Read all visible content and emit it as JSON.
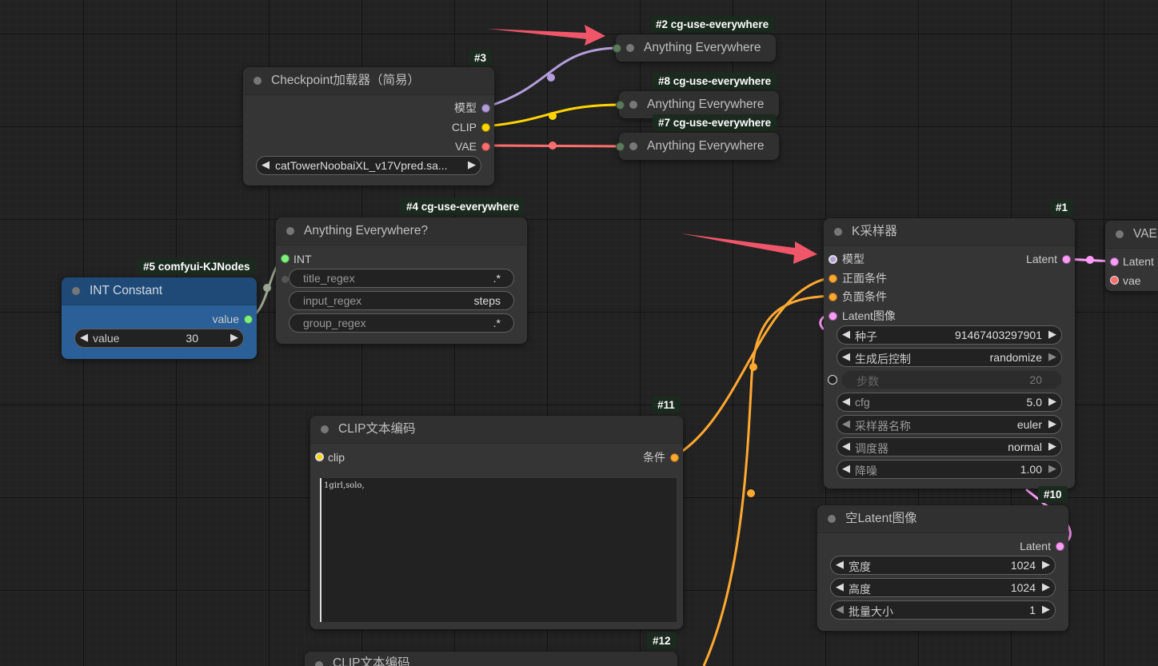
{
  "colors": {
    "model": "#b39ddb",
    "clip": "#ffd500",
    "vae": "#ff6e6e",
    "conditioning": "#ffa931",
    "latent": "#ff9cf9",
    "int": "#7ef07e",
    "annotation_arrow": "#f0566a"
  },
  "nodes": {
    "checkpoint": {
      "badge": "#3",
      "title": "Checkpoint加载器（简易）",
      "outputs": [
        "模型",
        "CLIP",
        "VAE"
      ],
      "ckpt_name": "catTowerNoobaiXL_v17Vpred.sa..."
    },
    "ae2": {
      "badge": "#2 cg-use-everywhere",
      "title": "Anything Everywhere"
    },
    "ae8": {
      "badge": "#8 cg-use-everywhere",
      "title": "Anything Everywhere"
    },
    "ae7": {
      "badge": "#7 cg-use-everywhere",
      "title": "Anything Everywhere"
    },
    "ae4": {
      "badge": "#4 cg-use-everywhere",
      "title": "Anything Everywhere?",
      "input": "INT",
      "widgets": [
        {
          "label": "title_regex",
          "value": ".*"
        },
        {
          "label": "input_regex",
          "value": "steps"
        },
        {
          "label": "group_regex",
          "value": ".*"
        }
      ]
    },
    "int_constant": {
      "badge": "#5 comfyui-KJNodes",
      "title": "INT Constant",
      "output": "value",
      "widget": {
        "label": "value",
        "value": "30"
      }
    },
    "ksampler": {
      "badge": "#1",
      "title": "K采样器",
      "inputs": [
        "模型",
        "正面条件",
        "负面条件",
        "Latent图像"
      ],
      "output": "Latent",
      "widgets": [
        {
          "label": "种子",
          "value": "91467403297901"
        },
        {
          "label": "生成后控制",
          "value": "randomize"
        },
        {
          "label": "步数",
          "value": "20"
        },
        {
          "label": "cfg",
          "value": "5.0"
        },
        {
          "label": "采样器名称",
          "value": "euler"
        },
        {
          "label": "调度器",
          "value": "normal"
        },
        {
          "label": "降噪",
          "value": "1.00"
        }
      ]
    },
    "vae_decode": {
      "title": "VAE",
      "inputs": [
        "Latent",
        "vae"
      ]
    },
    "clip_text_11": {
      "badge": "#11",
      "title": "CLIP文本编码",
      "input": "clip",
      "output": "条件",
      "text": "1girl,solo,"
    },
    "clip_text_12": {
      "badge": "#12",
      "title": "CLIP文本编码"
    },
    "empty_latent": {
      "badge": "#10",
      "title": "空Latent图像",
      "output": "Latent",
      "widgets": [
        {
          "label": "宽度",
          "value": "1024"
        },
        {
          "label": "高度",
          "value": "1024"
        },
        {
          "label": "批量大小",
          "value": "1"
        }
      ]
    }
  }
}
